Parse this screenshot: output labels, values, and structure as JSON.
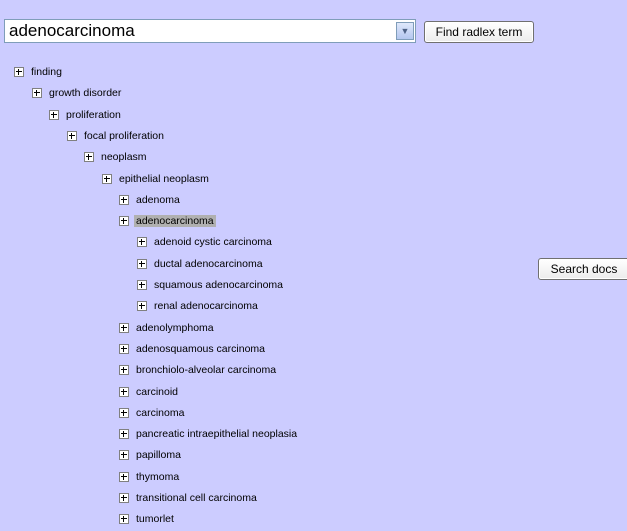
{
  "search": {
    "value": "adenocarcinoma"
  },
  "buttons": {
    "find": "Find radlex term",
    "docs": "Search docs"
  },
  "tree": [
    {
      "label": "finding",
      "level": 0
    },
    {
      "label": "growth disorder",
      "level": 1
    },
    {
      "label": "proliferation",
      "level": 2
    },
    {
      "label": "focal proliferation",
      "level": 3
    },
    {
      "label": "neoplasm",
      "level": 4
    },
    {
      "label": "epithelial neoplasm",
      "level": 5
    },
    {
      "label": "adenoma",
      "level": 6
    },
    {
      "label": "adenocarcinoma",
      "level": 6,
      "selected": true
    },
    {
      "label": "adenoid cystic carcinoma",
      "level": 7
    },
    {
      "label": "ductal adenocarcinoma",
      "level": 7
    },
    {
      "label": "squamous adenocarcinoma",
      "level": 7
    },
    {
      "label": "renal adenocarcinoma",
      "level": 7
    },
    {
      "label": "adenolymphoma",
      "level": 6
    },
    {
      "label": "adenosquamous carcinoma",
      "level": 6
    },
    {
      "label": "bronchiolo-alveolar carcinoma",
      "level": 6
    },
    {
      "label": "carcinoid",
      "level": 6
    },
    {
      "label": "carcinoma",
      "level": 6
    },
    {
      "label": "pancreatic intraepithelial neoplasia",
      "level": 6
    },
    {
      "label": "papilloma",
      "level": 6
    },
    {
      "label": "thymoma",
      "level": 6
    },
    {
      "label": "transitional cell carcinoma",
      "level": 6
    },
    {
      "label": "tumorlet",
      "level": 6
    }
  ]
}
